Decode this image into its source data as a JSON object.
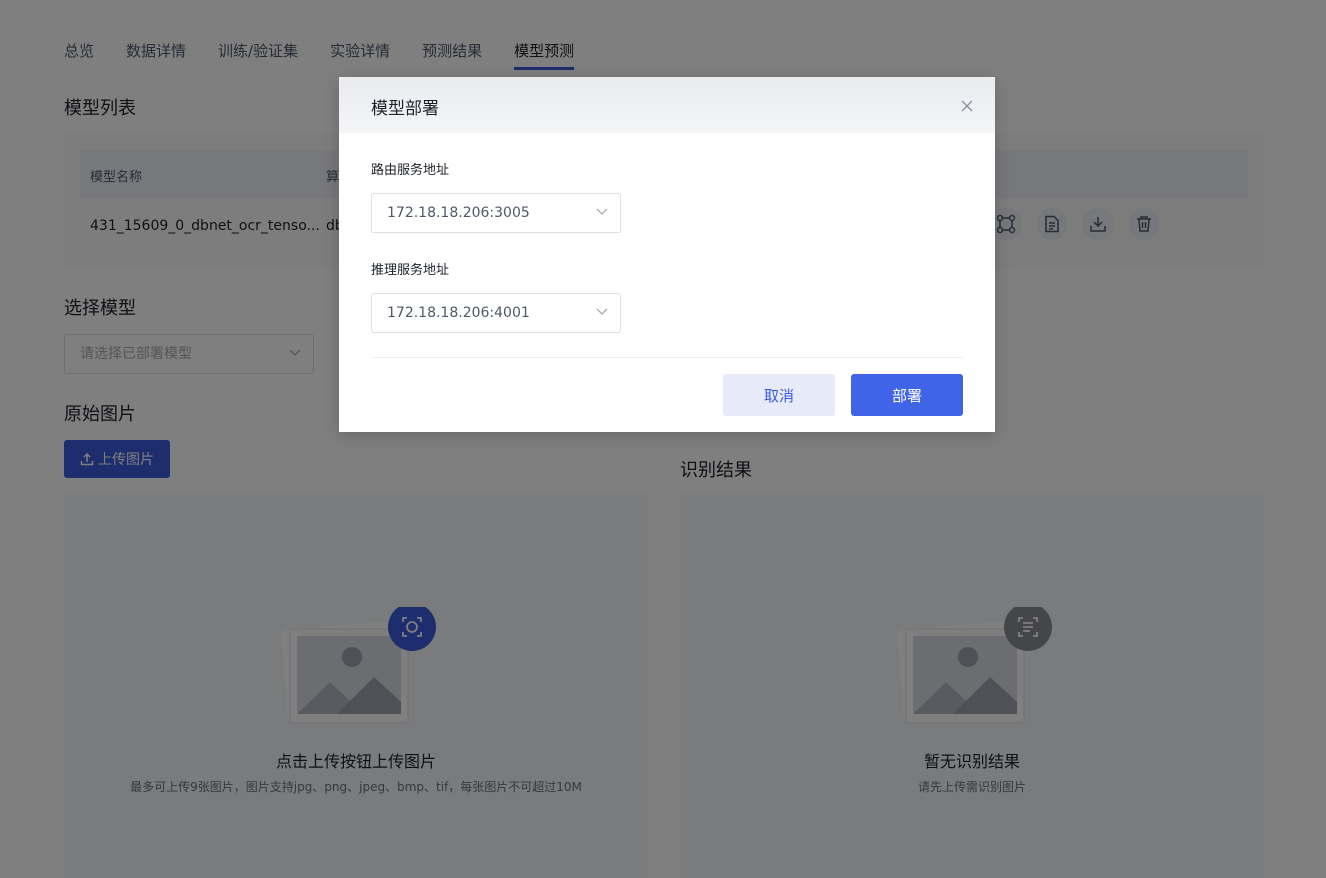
{
  "tabs": [
    {
      "label": "总览"
    },
    {
      "label": "数据详情"
    },
    {
      "label": "训练/验证集"
    },
    {
      "label": "实验详情"
    },
    {
      "label": "预测结果"
    },
    {
      "label": "模型预测"
    }
  ],
  "active_tab": "模型预测",
  "model_list": {
    "title": "模型列表",
    "columns": [
      "模型名称",
      "算"
    ],
    "rows": [
      {
        "name": "431_15609_0_dbnet_ocr_tenso...",
        "algo": "db"
      }
    ],
    "actions": [
      "deploy-icon",
      "document-icon",
      "download-icon",
      "trash-icon"
    ]
  },
  "select_model": {
    "title": "选择模型",
    "placeholder": "请选择已部署模型"
  },
  "original_image": {
    "title": "原始图片",
    "upload_label": "上传图片",
    "empty_title": "点击上传按钮上传图片",
    "empty_sub": "最多可上传9张图片，图片支持jpg、png、jpeg、bmp、tif，每张图片不可超过10M"
  },
  "result": {
    "title": "识别结果",
    "empty_title": "暂无识别结果",
    "empty_sub": "请先上传需识别图片"
  },
  "modal": {
    "title": "模型部署",
    "route_label": "路由服务地址",
    "route_value": "172.18.18.206:3005",
    "infer_label": "推理服务地址",
    "infer_value": "172.18.18.206:4001",
    "cancel_label": "取消",
    "confirm_label": "部署"
  },
  "colors": {
    "primary": "#3b5bdb",
    "primary_button": "#4064e8",
    "cancel_bg": "#e6eaf9"
  }
}
